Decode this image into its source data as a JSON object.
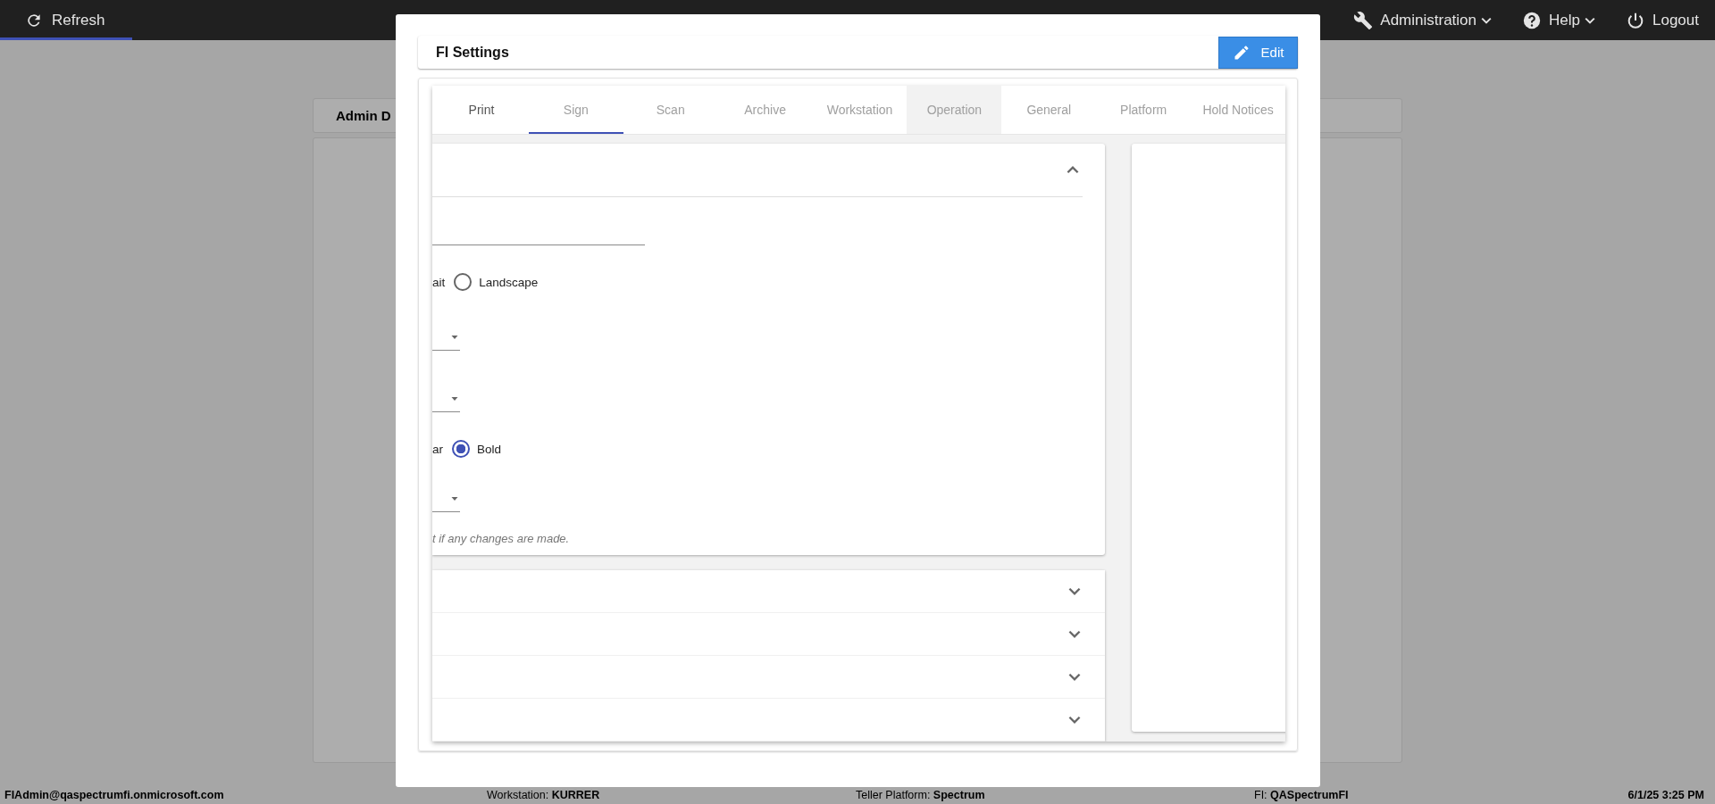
{
  "top_bar": {
    "refresh": "Refresh",
    "menus": [
      {
        "label": "Administration",
        "kind": "wrench",
        "dropdown": true
      },
      {
        "label": "Help",
        "kind": "help",
        "dropdown": true
      },
      {
        "label": "Logout",
        "kind": "power",
        "dropdown": false
      }
    ]
  },
  "background": {
    "card_title": "Admin D"
  },
  "modal": {
    "title": "FI Settings",
    "edit_button": "Edit",
    "tabs": [
      {
        "label": "Print",
        "selected": false,
        "disabled": false,
        "hovered": false
      },
      {
        "label": "Sign",
        "selected": true,
        "disabled": true,
        "hovered": false
      },
      {
        "label": "Scan",
        "selected": false,
        "disabled": true,
        "hovered": false
      },
      {
        "label": "Archive",
        "selected": false,
        "disabled": true,
        "hovered": false
      },
      {
        "label": "Workstation",
        "selected": false,
        "disabled": true,
        "hovered": false
      },
      {
        "label": "Operation",
        "selected": false,
        "disabled": true,
        "hovered": true
      },
      {
        "label": "General",
        "selected": false,
        "disabled": true,
        "hovered": false
      },
      {
        "label": "Platform",
        "selected": false,
        "disabled": true,
        "hovered": false
      },
      {
        "label": "Hold Notices",
        "selected": false,
        "disabled": true,
        "hovered": false
      }
    ],
    "section": {
      "expanded": true,
      "rows": [
        {
          "kind": "text_field"
        },
        {
          "kind": "radio",
          "leading": "ait",
          "options": [
            {
              "label": "Landscape",
              "selected": false
            }
          ]
        },
        {
          "kind": "select"
        },
        {
          "kind": "select"
        },
        {
          "kind": "radio",
          "leading": "ar",
          "options": [
            {
              "label": "Bold",
              "selected": true
            }
          ]
        },
        {
          "kind": "select"
        },
        {
          "kind": "note",
          "text": "t if any changes are made."
        }
      ]
    },
    "collapsed_sections": [
      {
        "expanded": false
      },
      {
        "expanded": false
      },
      {
        "expanded": false
      },
      {
        "expanded": false
      }
    ]
  },
  "status_bar": [
    {
      "value": "FIAdmin@qaspectrumfi.onmicrosoft.com"
    },
    {
      "label": "Workstation:",
      "value": "KURRER"
    },
    {
      "label": "Teller Platform:",
      "value": "Spectrum"
    },
    {
      "label": "FI:",
      "value": "QASpectrumFI"
    },
    {
      "value": "6/1/25 3:25 PM"
    }
  ]
}
